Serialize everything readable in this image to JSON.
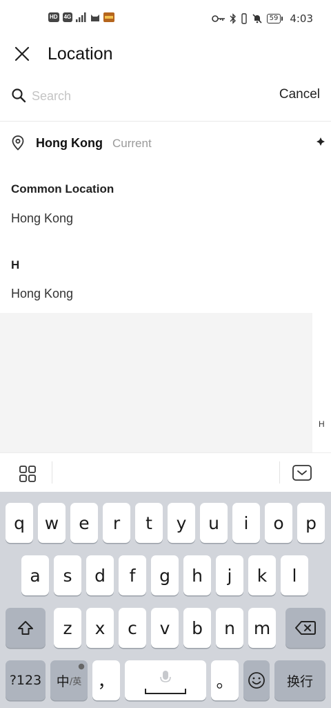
{
  "status_bar": {
    "left_chips": [
      "HD",
      "4G"
    ],
    "battery": "59",
    "time": "4:03"
  },
  "header": {
    "title": "Location",
    "close_icon": "close-icon"
  },
  "search": {
    "placeholder": "Search",
    "value": "",
    "cancel_label": "Cancel"
  },
  "current": {
    "city": "Hong Kong",
    "tag": "Current"
  },
  "sections": [
    {
      "title": "Common Location",
      "items": [
        "Hong Kong"
      ]
    },
    {
      "title": "H",
      "items": [
        "Hong Kong"
      ]
    }
  ],
  "index_bar": [
    "H"
  ],
  "keyboard": {
    "row1": [
      "q",
      "w",
      "e",
      "r",
      "t",
      "y",
      "u",
      "i",
      "o",
      "p"
    ],
    "row2": [
      "a",
      "s",
      "d",
      "f",
      "g",
      "h",
      "j",
      "k",
      "l"
    ],
    "row3": [
      "z",
      "x",
      "c",
      "v",
      "b",
      "n",
      "m"
    ],
    "numbers_key": "?123",
    "lang_key_main": "中",
    "lang_key_sub": "/英",
    "comma_key": "，",
    "period_key": "。",
    "enter_key": "换行"
  }
}
